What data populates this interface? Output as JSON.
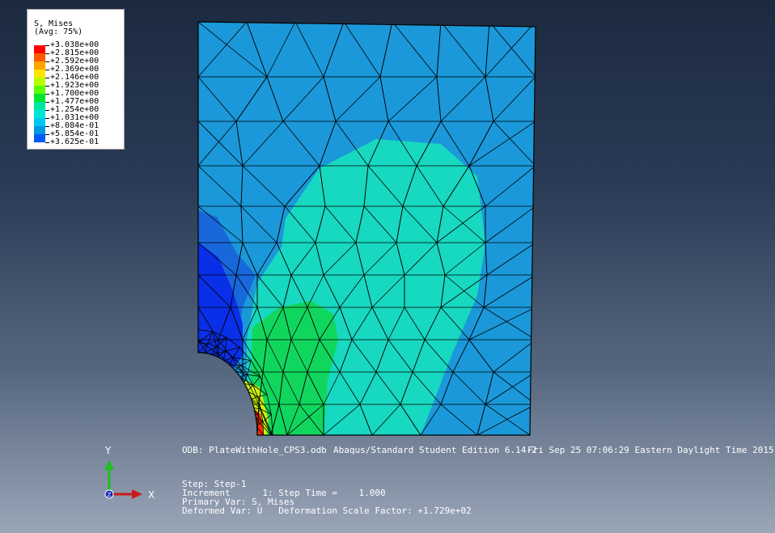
{
  "legend": {
    "title": "S, Mises",
    "subtitle": "(Avg: 75%)",
    "levels": [
      {
        "label": "+3.038e+00",
        "color": "#ff0000"
      },
      {
        "label": "+2.815e+00",
        "color": "#ff5a00"
      },
      {
        "label": "+2.592e+00",
        "color": "#ffa500"
      },
      {
        "label": "+2.369e+00",
        "color": "#ffe600"
      },
      {
        "label": "+2.146e+00",
        "color": "#b7ff00"
      },
      {
        "label": "+1.923e+00",
        "color": "#5aff00"
      },
      {
        "label": "+1.700e+00",
        "color": "#00e630"
      },
      {
        "label": "+1.477e+00",
        "color": "#00e6a0"
      },
      {
        "label": "+1.254e+00",
        "color": "#00e6d8"
      },
      {
        "label": "+1.031e+00",
        "color": "#00c8f0"
      },
      {
        "label": "+8.084e-01",
        "color": "#0099e6"
      },
      {
        "label": "+5.854e-01",
        "color": "#005af5"
      },
      {
        "label": "+3.625e-01",
        "color": "#0000ff"
      }
    ]
  },
  "colors": {
    "plate_base": "#1b98d9",
    "region_cyan": "#17d8c0",
    "region_green": "#11d65e",
    "region_blue_mid": "#1868db",
    "region_blue_dark": "#0a2fe8",
    "region_yellow": "#c8ef10",
    "region_red": "#ff2a00",
    "mesh_line": "#000000"
  },
  "info": {
    "odb": "ODB: PlateWithHole_CPS3.odb",
    "edition": "Abaqus/Standard Student Edition 6.14-2",
    "date": "Fri Sep 25 07:06:29 Eastern Daylight Time 2015",
    "step": "Step: Step-1",
    "increment": "Increment      1: Step Time =    1.000",
    "primary_var": "Primary Var: S, Mises",
    "deformed_var": "Deformed Var: U   Deformation Scale Factor: +1.729e+02"
  },
  "triad": {
    "y_label": "Y",
    "x_label": "X",
    "z_label": "Z"
  }
}
